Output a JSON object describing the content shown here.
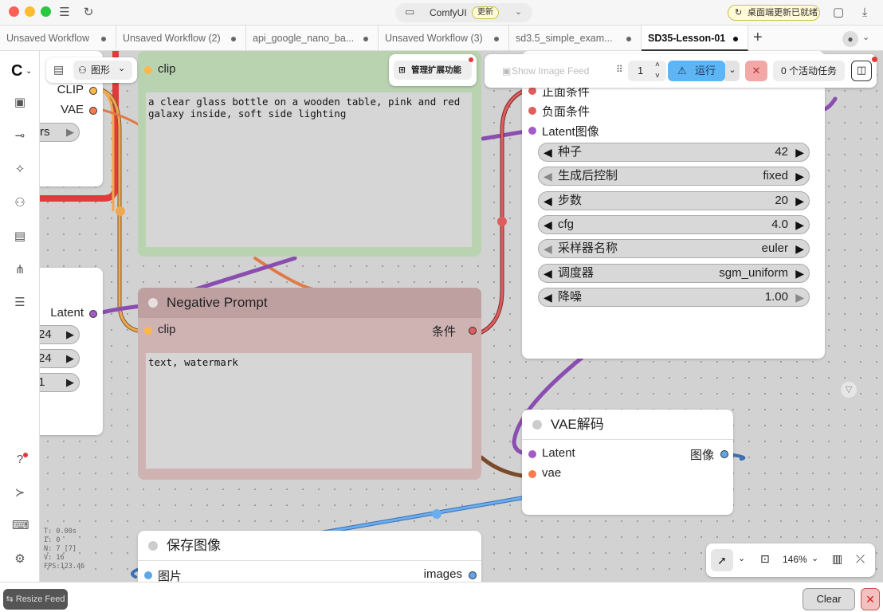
{
  "window": {
    "app_title": "ComfyUI",
    "update_badge": "更新",
    "desktop_update": "桌面端更新已就绪",
    "colors": {
      "close": "#ff5f57",
      "minimize": "#febc2e",
      "maximize": "#28c840"
    }
  },
  "tabs": [
    {
      "label": "Unsaved Workflow",
      "active": false
    },
    {
      "label": "Unsaved Workflow (2)",
      "active": false
    },
    {
      "label": "api_google_nano_ba...",
      "active": false
    },
    {
      "label": "Unsaved Workflow (3)",
      "active": false
    },
    {
      "label": "sd3.5_simple_exam...",
      "active": false
    },
    {
      "label": "SD35-Lesson-01",
      "active": true
    }
  ],
  "toolbar": {
    "graph_label": "图形",
    "manage_extensions": "管理扩展功能",
    "show_image_feed": "Show Image Feed",
    "batch_count": "1",
    "run_label": "运行",
    "active_tasks": "0 个活动任务"
  },
  "nodes": {
    "left_top": {
      "clip_label": "CLIP",
      "vae_label": "VAE",
      "widget_suffix": "rs"
    },
    "left_mid": {
      "latent_label": "Latent",
      "widgets": [
        "24",
        "24",
        "1"
      ]
    },
    "positive": {
      "clip_label": "clip",
      "text": "a clear glass bottle on a wooden table, pink and red galaxy inside, soft side lighting"
    },
    "negative": {
      "title": "Negative Prompt",
      "clip_label": "clip",
      "output_label": "条件",
      "text": "text, watermark"
    },
    "ksampler": {
      "inputs": [
        "正面条件",
        "负面条件",
        "Latent图像"
      ],
      "widgets": [
        {
          "name": "种子",
          "value": "42"
        },
        {
          "name": "生成后控制",
          "value": "fixed"
        },
        {
          "name": "步数",
          "value": "20"
        },
        {
          "name": "cfg",
          "value": "4.0"
        },
        {
          "name": "采样器名称",
          "value": "euler"
        },
        {
          "name": "调度器",
          "value": "sgm_uniform"
        },
        {
          "name": "降噪",
          "value": "1.00"
        }
      ]
    },
    "vae_decode": {
      "title": "VAE解码",
      "latent_label": "Latent",
      "vae_label": "vae",
      "output_label": "图像"
    },
    "save_image": {
      "title": "保存图像",
      "input_label": "图片",
      "output_label": "images"
    }
  },
  "stats": {
    "t": "T: 0.00s",
    "i": "I: 0",
    "n": "N: 7 [7]",
    "v": "V: 16",
    "fps": "FPS:123.46"
  },
  "canvas_controls": {
    "zoom": "146%"
  },
  "bottom": {
    "resize_feed": "Resize Feed",
    "clear": "Clear"
  },
  "colors": {
    "clip": "#ffb648",
    "conditioning": "#e05d5d",
    "latent": "#a35cc7",
    "vae": "#ff7a4a",
    "image": "#5ea6e8",
    "run_button": "#5db5f5",
    "positive_node": "#b9d3b0",
    "negative_node": "#cfb3b3"
  }
}
